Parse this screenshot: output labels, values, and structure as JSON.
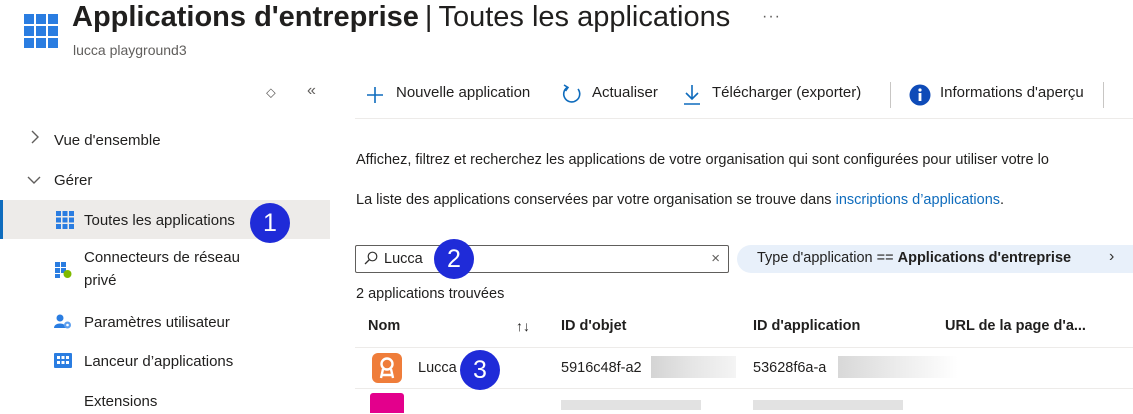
{
  "header": {
    "title": "Applications d'entreprise",
    "separator": "|",
    "subtitle": "Toutes les applications",
    "more": "···",
    "tenant": "lucca playground3"
  },
  "sidebar": {
    "sort_icon": "⬦",
    "collapse_icon": "«",
    "items": [
      {
        "label": "Vue d'ensemble",
        "icon": "chevron-right-icon"
      },
      {
        "label": "Gérer",
        "icon": "chevron-down-icon"
      },
      {
        "label": "Toutes les applications",
        "icon": "grid-icon",
        "active": true
      },
      {
        "label_line1": "Connecteurs de réseau",
        "label_line2": "privé",
        "icon": "connector-icon"
      },
      {
        "label": "Paramètres utilisateur",
        "icon": "users-settings-icon"
      },
      {
        "label": "Lanceur d’applications",
        "icon": "launcher-icon"
      },
      {
        "label": "Extensions",
        "icon": ""
      }
    ]
  },
  "toolbar": {
    "new_app": "Nouvelle application",
    "refresh": "Actualiser",
    "download": "Télécharger (exporter)",
    "preview_info": "Informations d'aperçu"
  },
  "main": {
    "intro": "Affichez, filtrez et recherchez les applications de votre organisation qui sont configurées pour utiliser votre lo",
    "list_text": "La liste des applications conservées par votre organisation se trouve dans ",
    "list_link": "inscriptions d’applications",
    "list_end": "."
  },
  "search": {
    "value": "Lucca",
    "clear": "×"
  },
  "filter": {
    "label": "Type d'application == ",
    "value": "Applications d'entreprise",
    "chevron": "›"
  },
  "results": {
    "count": "2 applications trouvées"
  },
  "table": {
    "headers": [
      "Nom",
      "ID d'objet",
      "ID d'application",
      "URL de la page d'a..."
    ],
    "sort_icon": "↑↓",
    "rows": [
      {
        "name": "Lucca",
        "object_id": "5916c48f-a2",
        "app_id": "53628f6a-a"
      },
      {
        "name": "",
        "object_id": "",
        "app_id": ""
      }
    ]
  },
  "badges": [
    "1",
    "2",
    "3"
  ],
  "colors": {
    "accent": "#0f6cbd",
    "badge": "#1f2bd8",
    "filter_bg": "#e8f0fa",
    "lucca_icon": "#ef7d3a",
    "row2_icon": "#e3008c"
  }
}
